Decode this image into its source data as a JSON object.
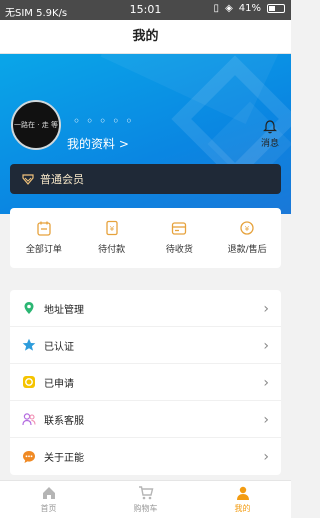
{
  "status": {
    "carrier": "无SIM 5.9K/s",
    "time": "15:01",
    "battery": "41%"
  },
  "nav": {
    "title": "我的"
  },
  "profile": {
    "name_mask": "◦◦◦◦◦",
    "link": "我的资料 >",
    "avatar_text": "一路在 · 走  等",
    "message_label": "消息"
  },
  "member": {
    "label": "普通会员"
  },
  "orders": [
    {
      "label": "全部订单",
      "icon": "order-list-icon"
    },
    {
      "label": "待付款",
      "icon": "wallet-icon"
    },
    {
      "label": "待收货",
      "icon": "delivery-icon"
    },
    {
      "label": "退款/售后",
      "icon": "refund-icon"
    }
  ],
  "menu": [
    {
      "label": "地址管理",
      "icon": "location-icon",
      "color": "#2bb673"
    },
    {
      "label": "已认证",
      "icon": "star-icon",
      "color": "#2d9cdb"
    },
    {
      "label": "已申请",
      "icon": "coin-icon",
      "color": "#f5c400"
    },
    {
      "label": "联系客服",
      "icon": "customer-service-icon",
      "color": "#b36be0"
    },
    {
      "label": "关于正能",
      "icon": "chat-icon",
      "color": "#f08a24"
    }
  ],
  "tabs": [
    {
      "label": "首页",
      "icon": "home-icon"
    },
    {
      "label": "购物车",
      "icon": "cart-icon"
    },
    {
      "label": "我的",
      "icon": "user-icon",
      "active": true
    }
  ],
  "colors": {
    "brand_blue": "#0a86e2",
    "accent_orange": "#f39c12",
    "member_bg": "#1f2937"
  }
}
